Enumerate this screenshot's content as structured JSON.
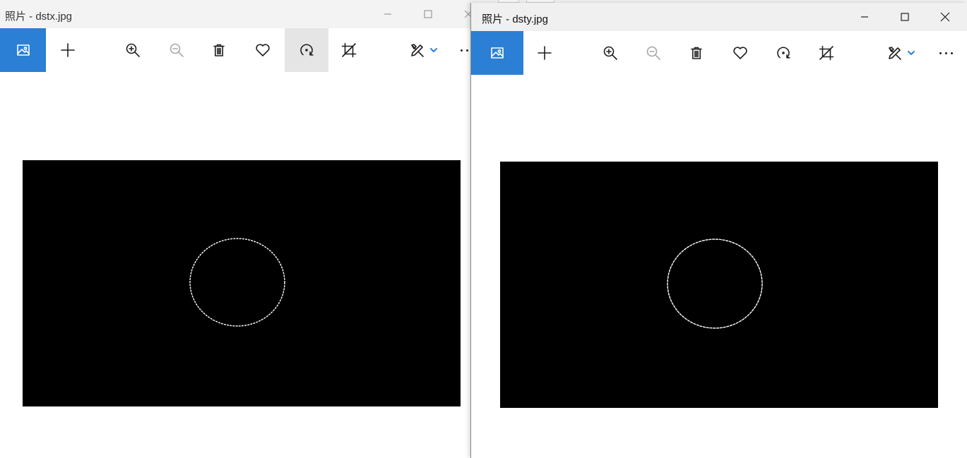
{
  "windows": [
    {
      "title": "照片 - dstx.jpg",
      "toolbar": {
        "view_icon": "photo-icon",
        "add_icon": "plus-icon",
        "zoom_in_icon": "zoom-in-icon",
        "zoom_out_icon": "zoom-out-icon",
        "delete_icon": "trash-icon",
        "favorite_icon": "heart-icon",
        "rotate_icon": "rotate-icon",
        "crop_icon": "crop-icon",
        "edit_icon": "edit-create-icon",
        "more_icon": "more-icon"
      }
    },
    {
      "title": "照片 - dsty.jpg",
      "toolbar": {
        "view_icon": "photo-icon",
        "add_icon": "plus-icon",
        "zoom_in_icon": "zoom-in-icon",
        "zoom_out_icon": "zoom-out-icon",
        "delete_icon": "trash-icon",
        "favorite_icon": "heart-icon",
        "rotate_icon": "rotate-icon",
        "crop_icon": "crop-icon",
        "edit_icon": "edit-create-icon",
        "more_icon": "more-icon"
      }
    }
  ],
  "colors": {
    "accent": "#2b7fd4",
    "image_background": "#000000",
    "circle_edge": "#ffffff"
  }
}
